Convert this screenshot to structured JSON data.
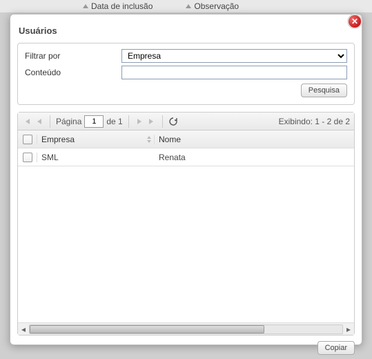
{
  "background": {
    "col1_label": "Data de inclusão",
    "col2_label": "Observação"
  },
  "dialog": {
    "title": "Usuários",
    "close_glyph": "✕",
    "filter": {
      "filter_by_label": "Filtrar por",
      "filter_by_selected": "Empresa",
      "content_label": "Conteúdo",
      "content_value": "",
      "search_button": "Pesquisa"
    },
    "toolbar": {
      "page_label": "Página",
      "page_value": "1",
      "of_label": "de 1",
      "showing_label": "Exibindo: 1 - 2 de 2"
    },
    "columns": {
      "empresa": "Empresa",
      "nome": "Nome"
    },
    "rows": [
      {
        "empresa": "SML",
        "nome": "Renata"
      }
    ],
    "footer": {
      "copy_button": "Copiar"
    }
  }
}
